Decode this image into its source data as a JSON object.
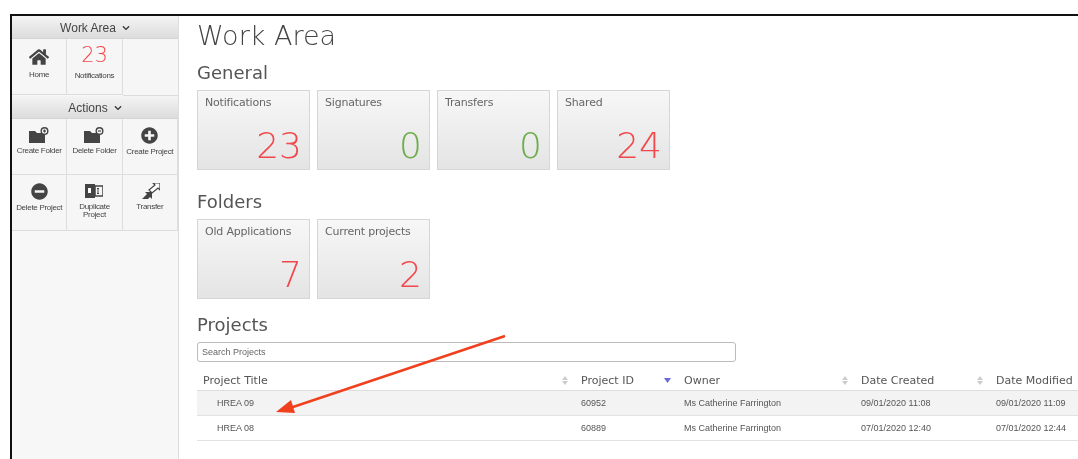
{
  "sidebar": {
    "sections": [
      {
        "title": "Work Area",
        "expanded": true,
        "tiles": [
          {
            "kind": "icon",
            "label": "Home"
          },
          {
            "kind": "count",
            "count": "23",
            "label": "Notifications"
          }
        ]
      },
      {
        "title": "Actions",
        "expanded": true,
        "tiles": [
          {
            "kind": "icon",
            "label": "Create Folder"
          },
          {
            "kind": "icon",
            "label": "Delete Folder"
          },
          {
            "kind": "icon",
            "label": "Create Project"
          },
          {
            "kind": "icon",
            "label": "Delete Project"
          },
          {
            "kind": "icon",
            "label": "Duplicate Project"
          },
          {
            "kind": "icon",
            "label": "Transfer"
          }
        ]
      }
    ]
  },
  "page_title": "Work Area",
  "general": {
    "heading": "General",
    "tiles": [
      {
        "label": "Notifications",
        "value": "23",
        "color": "#f0484b"
      },
      {
        "label": "Signatures",
        "value": "0",
        "color": "#6fae4f"
      },
      {
        "label": "Transfers",
        "value": "0",
        "color": "#6fae4f"
      },
      {
        "label": "Shared",
        "value": "24",
        "color": "#f0484b"
      }
    ]
  },
  "folders": {
    "heading": "Folders",
    "tiles": [
      {
        "label": "Old Applications",
        "value": "7",
        "color": "#f0484b"
      },
      {
        "label": "Current projects",
        "value": "2",
        "color": "#f0484b"
      }
    ]
  },
  "projects": {
    "heading": "Projects",
    "search": {
      "placeholder": "Search Projects"
    },
    "columns": [
      {
        "label": "Project Title",
        "sorted": false
      },
      {
        "label": "Project ID",
        "sorted": true
      },
      {
        "label": "Owner",
        "sorted": false
      },
      {
        "label": "Date Created",
        "sorted": false
      },
      {
        "label": "Date Modified"
      }
    ],
    "rows": [
      {
        "cells": [
          "HREA 09",
          "60952",
          "Ms Catherine Farrington",
          "09/01/2020 11:08",
          "09/01/2020 11:09"
        ]
      },
      {
        "cells": [
          "HREA 08",
          "60889",
          "Ms Catherine Farrington",
          "07/01/2020 12:40",
          "07/01/2020 12:44"
        ]
      }
    ]
  },
  "annotations": [
    {
      "kind": "arrow",
      "color": "#f0401e"
    }
  ]
}
